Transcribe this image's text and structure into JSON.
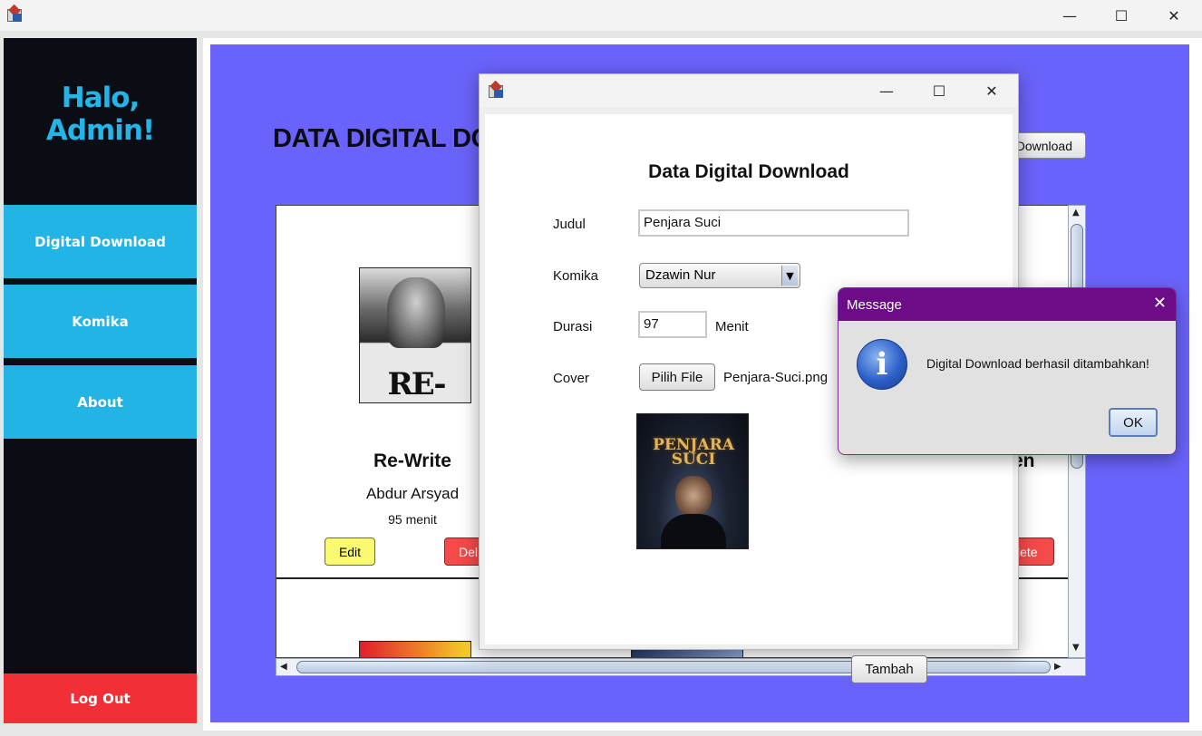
{
  "window": {
    "minimize": "—",
    "maximize": "☐",
    "close": "✕"
  },
  "sidebar": {
    "greeting": "Halo, Admin!",
    "items": [
      {
        "label": "Digital Download"
      },
      {
        "label": "Komika"
      },
      {
        "label": "About"
      }
    ],
    "logout": "Log Out"
  },
  "main": {
    "title": "DATA DIGITAL DO",
    "add_button": "Download",
    "cards": [
      {
        "cover_text": "RE-WRITE",
        "title": "Re-Write",
        "author": "Abdur Arsyad",
        "duration": "95 menit",
        "edit": "Edit",
        "delete": "Del"
      },
      {
        "title": "en",
        "delete": "lete"
      }
    ]
  },
  "dialog": {
    "minimize": "—",
    "maximize": "☐",
    "close": "✕",
    "heading": "Data Digital Download",
    "fields": {
      "judul_label": "Judul",
      "judul_value": "Penjara Suci",
      "komika_label": "Komika",
      "komika_value": "Dzawin Nur",
      "durasi_label": "Durasi",
      "durasi_value": "97",
      "durasi_unit": "Menit",
      "cover_label": "Cover",
      "pick_file": "Pilih File",
      "file_name": "Penjara-Suci.png"
    },
    "preview_title": "PENJARA SUCI",
    "submit": "Tambah"
  },
  "message": {
    "title": "Message",
    "close": "✕",
    "icon": "i",
    "text": "Digital Download berhasil ditambahkan!",
    "ok": "OK"
  },
  "colors": {
    "sidebar_bg": "#0b0d15",
    "nav_accent": "#22b4e5",
    "logout": "#f22f37",
    "content_bg": "#6a63fb",
    "message_title": "#6c0d87"
  }
}
